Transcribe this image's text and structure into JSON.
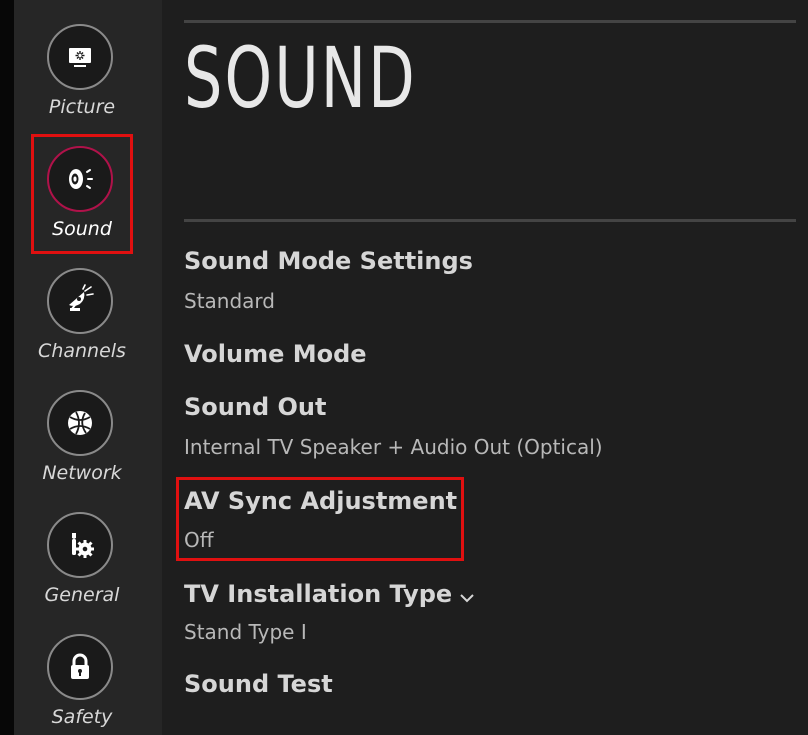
{
  "sidebar": {
    "items": [
      {
        "label": "Picture",
        "icon": "picture-icon"
      },
      {
        "label": "Sound",
        "icon": "sound-icon",
        "active": true
      },
      {
        "label": "Channels",
        "icon": "channels-icon"
      },
      {
        "label": "Network",
        "icon": "network-icon"
      },
      {
        "label": "General",
        "icon": "general-icon"
      },
      {
        "label": "Safety",
        "icon": "lock-icon"
      }
    ]
  },
  "main": {
    "title": "SOUND",
    "settings": [
      {
        "title": "Sound Mode Settings",
        "value": "Standard"
      },
      {
        "title": "Volume Mode"
      },
      {
        "title": "Sound Out",
        "value": "Internal TV Speaker + Audio Out (Optical)"
      },
      {
        "title": "AV Sync Adjustment",
        "value": "Off"
      },
      {
        "title": "TV Installation Type",
        "value": "Stand Type I",
        "icon": "chevron-down-icon"
      },
      {
        "title": "Sound Test"
      }
    ]
  },
  "colors": {
    "active_ring": "#b0124a",
    "highlight_box": "#e01010",
    "background": "#1e1e1e"
  }
}
